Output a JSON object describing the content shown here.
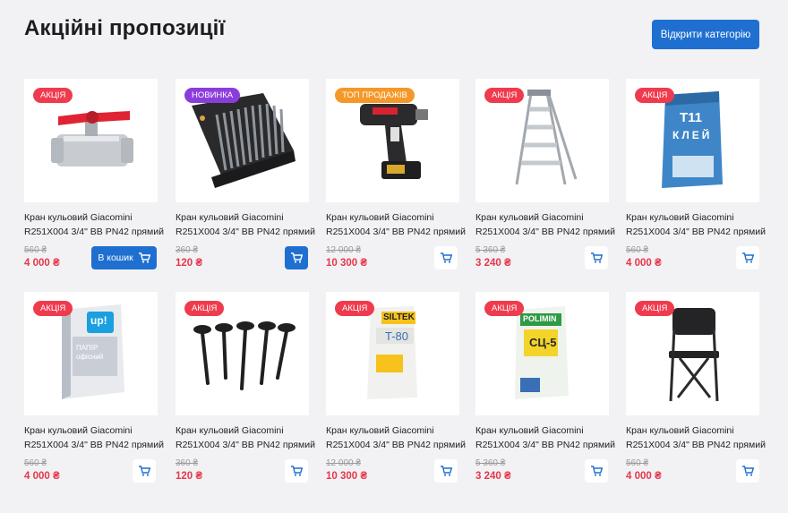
{
  "header": {
    "title": "Акційні пропозиції",
    "open_label": "Відкрити категорію"
  },
  "colors": {
    "accent": "#1f6fd1",
    "price": "#e4374b",
    "badge_sale": "#ef3b4e",
    "badge_new": "#8b3ddb",
    "badge_top": "#f5982a"
  },
  "products": [
    {
      "badge": "АКЦІЯ",
      "name": "Кран кульовий Giacomini R251X004 3/4\" ВВ PN42 прямий",
      "old_price": "560 ₴",
      "price": "4 000 ₴",
      "image": "ball-valve-image",
      "cart_label": "В кошик"
    },
    {
      "badge": "НОВИНКА",
      "name": "Кран кульовий Giacomini R251X004 3/4\" ВВ PN42 прямий",
      "old_price": "360 ₴",
      "price": "120 ₴",
      "image": "drill-bit-set-image"
    },
    {
      "badge": "ТОП ПРОДАЖІВ",
      "name": "Кран кульовий Giacomini R251X004 3/4\" ВВ PN42 прямий",
      "old_price": "12 000 ₴",
      "price": "10 300 ₴",
      "image": "cordless-drill-image"
    },
    {
      "badge": "АКЦІЯ",
      "name": "Кран кульовий Giacomini R251X004 3/4\" ВВ PN42 прямий",
      "old_price": "5 360 ₴",
      "price": "3 240 ₴",
      "image": "step-ladder-image"
    },
    {
      "badge": "АКЦІЯ",
      "name": "Кран кульовий Giacomini R251X004 3/4\" ВВ PN42 прямий",
      "old_price": "560 ₴",
      "price": "4 000 ₴",
      "image": "tile-adhesive-bag-image",
      "bag_text": "КЛЕЙ",
      "bag_code": "T11"
    },
    {
      "badge": "АКЦІЯ",
      "name": "Кран кульовий Giacomini R251X004 3/4\" ВВ PN42 прямий",
      "old_price": "560 ₴",
      "price": "4 000 ₴",
      "image": "paper-pack-image",
      "pack_logo": "up!",
      "pack_text": "ПАПІР офісний"
    },
    {
      "badge": "АКЦІЯ",
      "name": "Кран кульовий Giacomini R251X004 3/4\" ВВ PN42 прямий",
      "old_price": "360 ₴",
      "price": "120 ₴",
      "image": "garden-solar-lights-image"
    },
    {
      "badge": "АКЦІЯ",
      "name": "Кран кульовий Giacomini R251X004 3/4\" ВВ PN42 прямий",
      "old_price": "12 000 ₴",
      "price": "10 300 ₴",
      "image": "siltek-bag-image",
      "bag_text": "SILTEK",
      "bag_code": "T-80"
    },
    {
      "badge": "АКЦІЯ",
      "name": "Кран кульовий Giacomini R251X004 3/4\" ВВ PN42 прямий",
      "old_price": "5 360 ₴",
      "price": "3 240 ₴",
      "image": "polimin-bag-image",
      "bag_text": "POLIMIN",
      "bag_code": "СЦ-5"
    },
    {
      "badge": "АКЦІЯ",
      "name": "Кран кульовий Giacomini R251X004 3/4\" ВВ PN42 прямий",
      "old_price": "560 ₴",
      "price": "4 000 ₴",
      "image": "folding-chair-image"
    }
  ]
}
